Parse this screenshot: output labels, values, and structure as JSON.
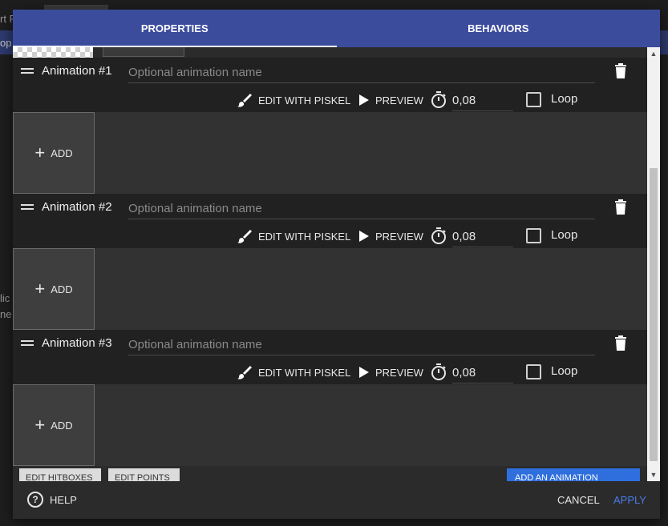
{
  "background": {
    "text_top": "rt P",
    "text_strip": "op",
    "text_left1": "lic",
    "text_left2": "ne"
  },
  "tabs": [
    {
      "label": "PROPERTIES",
      "active": true
    },
    {
      "label": "BEHAVIORS",
      "active": false
    }
  ],
  "animations": [
    {
      "title": "Animation #1",
      "name_placeholder": "Optional animation name",
      "edit_label": "EDIT WITH PISKEL",
      "preview_label": "PREVIEW",
      "duration": "0,08",
      "loop_label": "Loop",
      "loop_checked": false,
      "add_label": "ADD"
    },
    {
      "title": "Animation #2",
      "name_placeholder": "Optional animation name",
      "edit_label": "EDIT WITH PISKEL",
      "preview_label": "PREVIEW",
      "duration": "0,08",
      "loop_label": "Loop",
      "loop_checked": false,
      "add_label": "ADD"
    },
    {
      "title": "Animation #3",
      "name_placeholder": "Optional animation name",
      "edit_label": "EDIT WITH PISKEL",
      "preview_label": "PREVIEW",
      "duration": "0,08",
      "loop_label": "Loop",
      "loop_checked": false,
      "add_label": "ADD"
    }
  ],
  "bottom_buttons": {
    "edit_hitboxes": "EDIT HITBOXES",
    "edit_points": "EDIT POINTS",
    "add_animation": "ADD AN ANIMATION"
  },
  "footer": {
    "help": "HELP",
    "cancel": "CANCEL",
    "apply": "APPLY"
  },
  "colors": {
    "tab_bar": "#3c4c9d",
    "apply_accent": "#4a7ce8",
    "add_animation_button": "#2e6fdd"
  },
  "icons": [
    "drag-handle-icon",
    "trash-icon",
    "brush-icon",
    "play-icon",
    "timer-icon",
    "help-icon",
    "scroll-up-icon",
    "scroll-down-icon"
  ]
}
